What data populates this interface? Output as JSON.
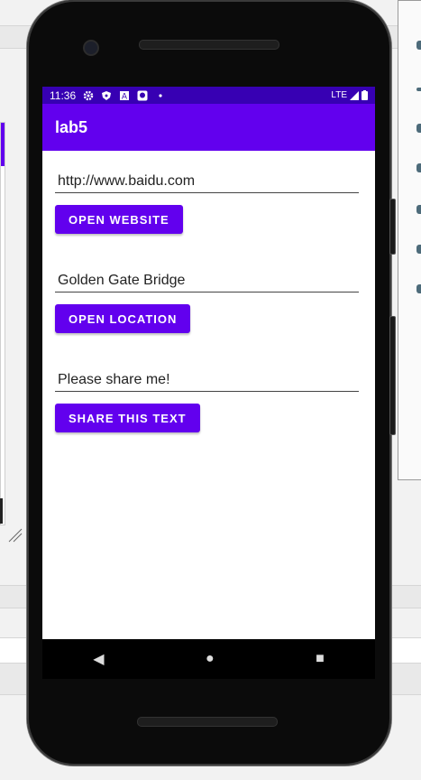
{
  "status_bar": {
    "time": "11:36",
    "network": "LTE",
    "icons": [
      "gear-icon",
      "shield-icon",
      "a-icon",
      "assistant-icon",
      "dot-icon"
    ]
  },
  "app_bar": {
    "title": "lab5"
  },
  "website": {
    "value": "http://www.baidu.com",
    "button_label": "OPEN WEBSITE"
  },
  "location": {
    "value": "Golden Gate Bridge",
    "button_label": "OPEN LOCATION"
  },
  "share": {
    "value": "Please share me!",
    "button_label": "SHARE THIS TEXT"
  },
  "nav_bar": {
    "back": "◀",
    "home": "●",
    "recents": "■"
  },
  "colors": {
    "primary": "#6200ee",
    "primary_dark": "#3700b3"
  }
}
